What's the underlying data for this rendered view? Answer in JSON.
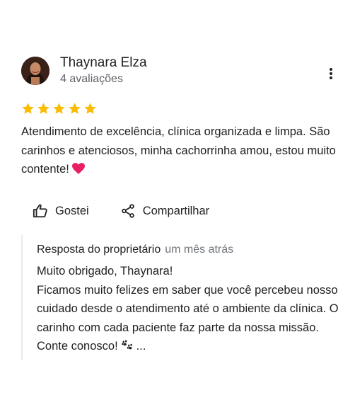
{
  "review": {
    "author_name": "Thaynara Elza",
    "author_meta": "4 avaliações",
    "rating": 5,
    "rating_max": 5,
    "text": "Atendimento de excelência, clínica organizada e limpa. São carinhos e atenciosos, minha cachorrinha amou, estou muito contente!",
    "text_emoji": "heart-emoji"
  },
  "actions": {
    "like_label": "Gostei",
    "share_label": "Compartilhar"
  },
  "owner_reply": {
    "label": "Resposta do proprietário",
    "time": "um mês atrás",
    "greeting": "Muito obrigado, Thaynara!",
    "text": "Ficamos muito felizes em saber que você percebeu nosso cuidado desde o atendimento até o ambiente da clínica. O carinho com cada paciente faz parte da nossa missão. Conte conosco!",
    "emoji": "paw-prints-emoji",
    "truncation": "..."
  },
  "colors": {
    "star": "#fbbc04",
    "text": "#202124",
    "muted": "#5f6368",
    "heart": "#e91e63",
    "divider": "#e8eaed"
  }
}
